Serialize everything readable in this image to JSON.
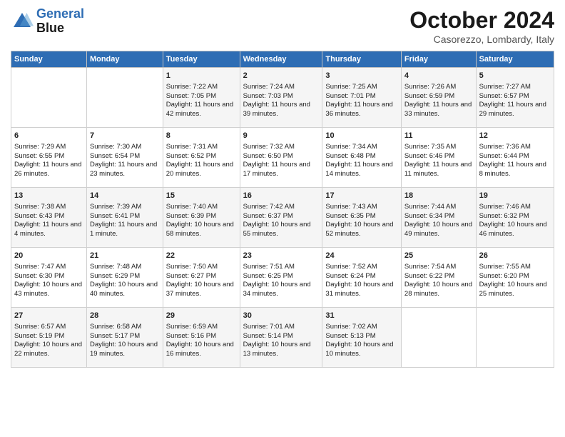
{
  "logo": {
    "line1": "General",
    "line2": "Blue"
  },
  "title": "October 2024",
  "location": "Casorezzo, Lombardy, Italy",
  "days_header": [
    "Sunday",
    "Monday",
    "Tuesday",
    "Wednesday",
    "Thursday",
    "Friday",
    "Saturday"
  ],
  "weeks": [
    [
      {
        "day": "",
        "data": ""
      },
      {
        "day": "",
        "data": ""
      },
      {
        "day": "1",
        "data": "Sunrise: 7:22 AM\nSunset: 7:05 PM\nDaylight: 11 hours and 42 minutes."
      },
      {
        "day": "2",
        "data": "Sunrise: 7:24 AM\nSunset: 7:03 PM\nDaylight: 11 hours and 39 minutes."
      },
      {
        "day": "3",
        "data": "Sunrise: 7:25 AM\nSunset: 7:01 PM\nDaylight: 11 hours and 36 minutes."
      },
      {
        "day": "4",
        "data": "Sunrise: 7:26 AM\nSunset: 6:59 PM\nDaylight: 11 hours and 33 minutes."
      },
      {
        "day": "5",
        "data": "Sunrise: 7:27 AM\nSunset: 6:57 PM\nDaylight: 11 hours and 29 minutes."
      }
    ],
    [
      {
        "day": "6",
        "data": "Sunrise: 7:29 AM\nSunset: 6:55 PM\nDaylight: 11 hours and 26 minutes."
      },
      {
        "day": "7",
        "data": "Sunrise: 7:30 AM\nSunset: 6:54 PM\nDaylight: 11 hours and 23 minutes."
      },
      {
        "day": "8",
        "data": "Sunrise: 7:31 AM\nSunset: 6:52 PM\nDaylight: 11 hours and 20 minutes."
      },
      {
        "day": "9",
        "data": "Sunrise: 7:32 AM\nSunset: 6:50 PM\nDaylight: 11 hours and 17 minutes."
      },
      {
        "day": "10",
        "data": "Sunrise: 7:34 AM\nSunset: 6:48 PM\nDaylight: 11 hours and 14 minutes."
      },
      {
        "day": "11",
        "data": "Sunrise: 7:35 AM\nSunset: 6:46 PM\nDaylight: 11 hours and 11 minutes."
      },
      {
        "day": "12",
        "data": "Sunrise: 7:36 AM\nSunset: 6:44 PM\nDaylight: 11 hours and 8 minutes."
      }
    ],
    [
      {
        "day": "13",
        "data": "Sunrise: 7:38 AM\nSunset: 6:43 PM\nDaylight: 11 hours and 4 minutes."
      },
      {
        "day": "14",
        "data": "Sunrise: 7:39 AM\nSunset: 6:41 PM\nDaylight: 11 hours and 1 minute."
      },
      {
        "day": "15",
        "data": "Sunrise: 7:40 AM\nSunset: 6:39 PM\nDaylight: 10 hours and 58 minutes."
      },
      {
        "day": "16",
        "data": "Sunrise: 7:42 AM\nSunset: 6:37 PM\nDaylight: 10 hours and 55 minutes."
      },
      {
        "day": "17",
        "data": "Sunrise: 7:43 AM\nSunset: 6:35 PM\nDaylight: 10 hours and 52 minutes."
      },
      {
        "day": "18",
        "data": "Sunrise: 7:44 AM\nSunset: 6:34 PM\nDaylight: 10 hours and 49 minutes."
      },
      {
        "day": "19",
        "data": "Sunrise: 7:46 AM\nSunset: 6:32 PM\nDaylight: 10 hours and 46 minutes."
      }
    ],
    [
      {
        "day": "20",
        "data": "Sunrise: 7:47 AM\nSunset: 6:30 PM\nDaylight: 10 hours and 43 minutes."
      },
      {
        "day": "21",
        "data": "Sunrise: 7:48 AM\nSunset: 6:29 PM\nDaylight: 10 hours and 40 minutes."
      },
      {
        "day": "22",
        "data": "Sunrise: 7:50 AM\nSunset: 6:27 PM\nDaylight: 10 hours and 37 minutes."
      },
      {
        "day": "23",
        "data": "Sunrise: 7:51 AM\nSunset: 6:25 PM\nDaylight: 10 hours and 34 minutes."
      },
      {
        "day": "24",
        "data": "Sunrise: 7:52 AM\nSunset: 6:24 PM\nDaylight: 10 hours and 31 minutes."
      },
      {
        "day": "25",
        "data": "Sunrise: 7:54 AM\nSunset: 6:22 PM\nDaylight: 10 hours and 28 minutes."
      },
      {
        "day": "26",
        "data": "Sunrise: 7:55 AM\nSunset: 6:20 PM\nDaylight: 10 hours and 25 minutes."
      }
    ],
    [
      {
        "day": "27",
        "data": "Sunrise: 6:57 AM\nSunset: 5:19 PM\nDaylight: 10 hours and 22 minutes."
      },
      {
        "day": "28",
        "data": "Sunrise: 6:58 AM\nSunset: 5:17 PM\nDaylight: 10 hours and 19 minutes."
      },
      {
        "day": "29",
        "data": "Sunrise: 6:59 AM\nSunset: 5:16 PM\nDaylight: 10 hours and 16 minutes."
      },
      {
        "day": "30",
        "data": "Sunrise: 7:01 AM\nSunset: 5:14 PM\nDaylight: 10 hours and 13 minutes."
      },
      {
        "day": "31",
        "data": "Sunrise: 7:02 AM\nSunset: 5:13 PM\nDaylight: 10 hours and 10 minutes."
      },
      {
        "day": "",
        "data": ""
      },
      {
        "day": "",
        "data": ""
      }
    ]
  ]
}
